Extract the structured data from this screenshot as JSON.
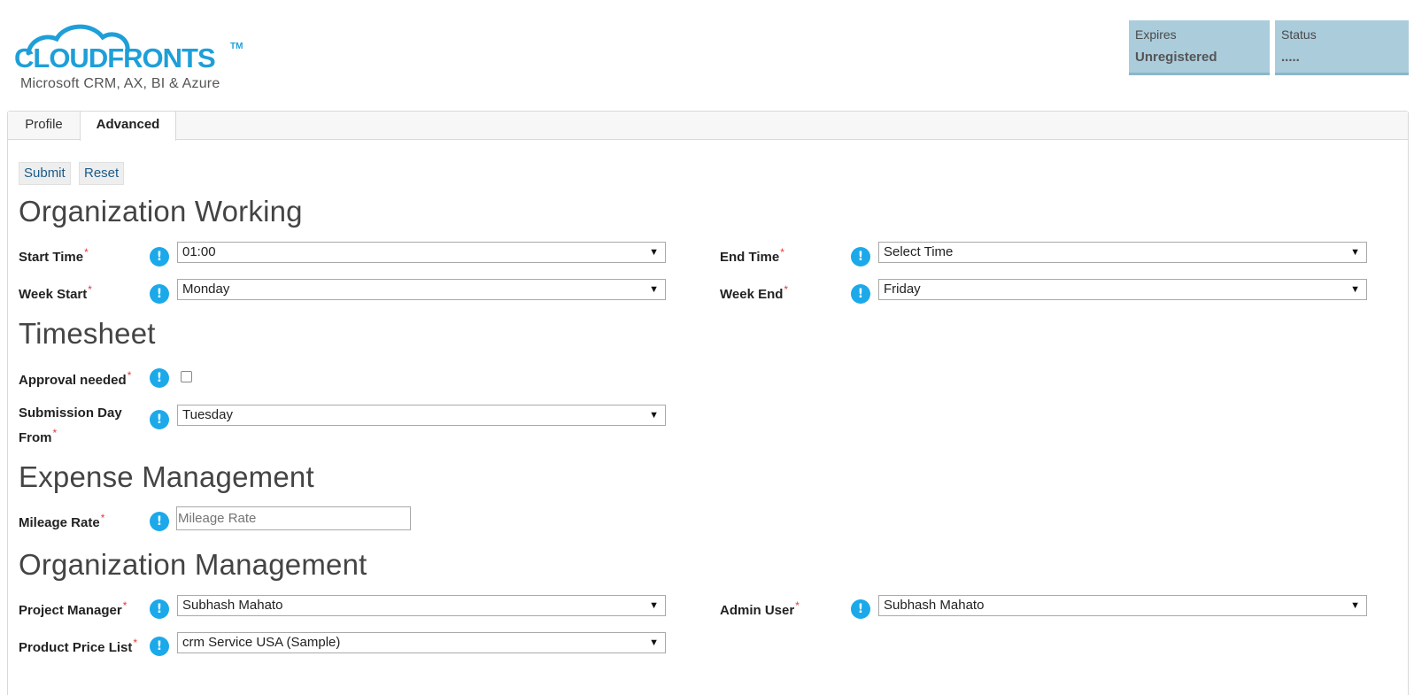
{
  "header": {
    "logo_text": "CLOUDFRONTS",
    "logo_tm": "TM",
    "logo_tagline": "Microsoft CRM, AX, BI & Azure",
    "expires_caption": "Expires",
    "expires_value": "Unregistered",
    "status_caption": "Status",
    "status_value": "....."
  },
  "tabs": [
    {
      "label": "Profile",
      "active": false
    },
    {
      "label": "Advanced",
      "active": true
    }
  ],
  "toolbar": {
    "submit_label": "Submit",
    "reset_label": "Reset"
  },
  "sections": {
    "org_working": {
      "title": "Organization Working",
      "start_time": {
        "label": "Start Time",
        "value": "01:00"
      },
      "end_time": {
        "label": "End Time",
        "value": "Select Time"
      },
      "week_start": {
        "label": "Week Start",
        "value": "Monday"
      },
      "week_end": {
        "label": "Week End",
        "value": "Friday"
      }
    },
    "timesheet": {
      "title": "Timesheet",
      "approval_needed": {
        "label": "Approval needed",
        "checked": false
      },
      "submission_day": {
        "label_line1": "Submission Day",
        "label_line2": "From",
        "value": "Tuesday"
      }
    },
    "expense": {
      "title": "Expense Management",
      "mileage_rate": {
        "label": "Mileage Rate",
        "placeholder": "Mileage Rate"
      }
    },
    "org_management": {
      "title": "Organization Management",
      "project_manager": {
        "label": "Project Manager",
        "value": "Subhash Mahato"
      },
      "admin_user": {
        "label": "Admin User",
        "value": "Subhash Mahato"
      },
      "price_list": {
        "label": "Product Price List",
        "value": "crm Service USA (Sample)"
      }
    }
  },
  "common": {
    "required_mark": "*",
    "info_glyph": "!",
    "dropdown_arrow": "▼"
  },
  "colors": {
    "info_icon": "#1ba9ea",
    "status_box": "#abccdb",
    "logo_blue": "#1e9fd8",
    "required": "#e23b3b"
  },
  "icons": {
    "info": "info-icon",
    "dropdown": "chevron-down-icon"
  }
}
